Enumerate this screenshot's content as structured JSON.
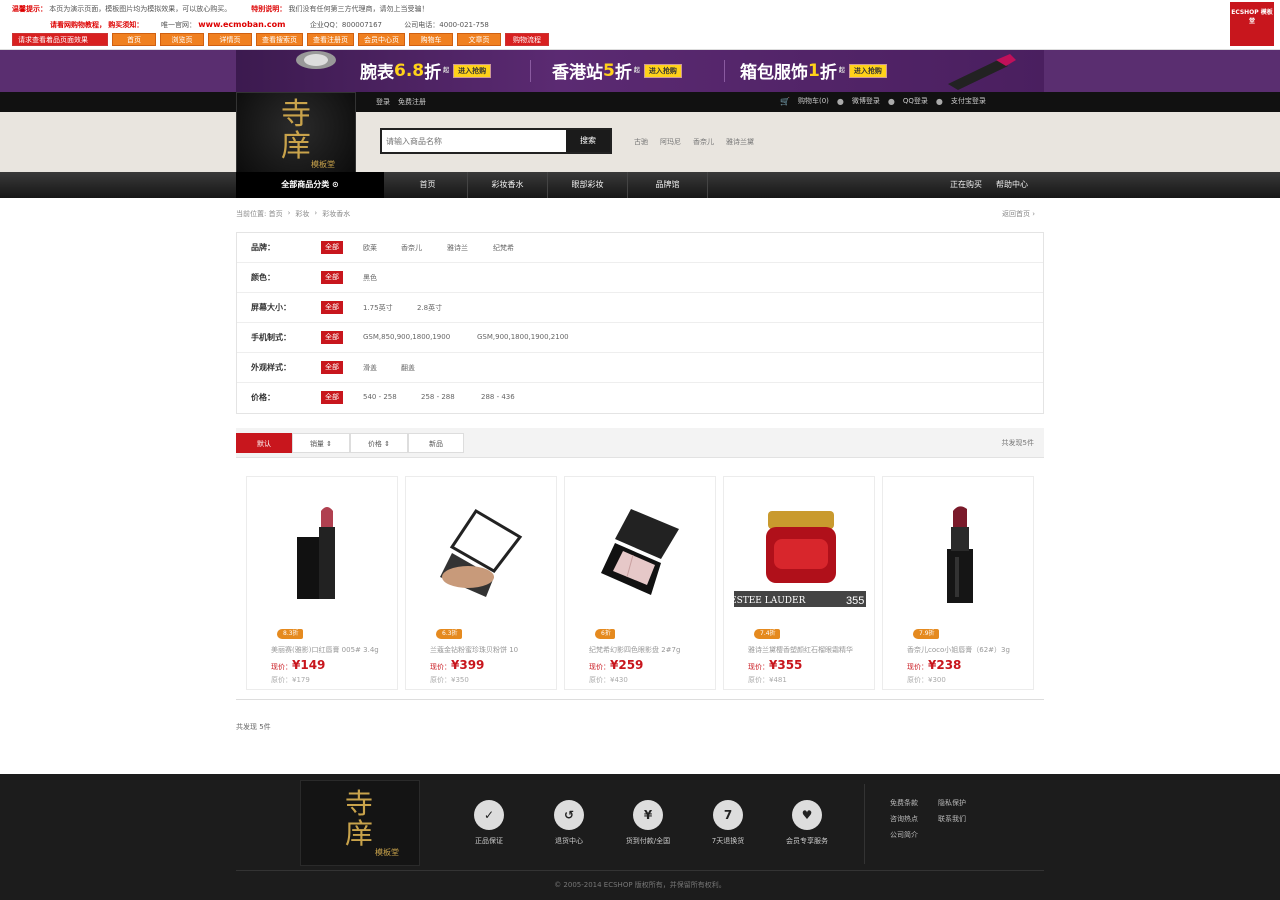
{
  "demo": {
    "line1_prefix": "温馨提示：",
    "line1_text": "本页为演示页面，模板图片均为模拟效果，可以放心购买。",
    "line1_hint": "特别说明：",
    "line1_hint_text": "我们没有任何第三方代理商，请勿上当受骗！",
    "line2_prefix": "请看网购物教程，",
    "line2_notice": "购买须知：",
    "line2_site_label": "唯一官网：",
    "line2_site": "www.ecmoban.com",
    "line2_qq": "企业QQ：800007167",
    "line2_phone": "公司电话：4000-021-758",
    "buttons": [
      "请求查看着品页面效果",
      "首页",
      "浏览页",
      "详情页",
      "查看搜索页",
      "查看注册页",
      "会员中心页",
      "购物车",
      "文章页",
      "购物流程"
    ],
    "ecs_logo": "ECSHOP 模板堂"
  },
  "banner": {
    "promos": [
      {
        "text": "腕表",
        "num": "6.8",
        "unit": "折",
        "small": "起",
        "go": "进入抢购"
      },
      {
        "text": "香港站",
        "num": "5",
        "unit": "折",
        "small": "起",
        "go": "进入抢购"
      },
      {
        "text": "箱包服饰",
        "num": "1",
        "unit": "折",
        "small": "起",
        "go": "进入抢购"
      }
    ]
  },
  "topstrip": {
    "login": "登录",
    "register": "免费注册",
    "cart": "购物车(0)",
    "weibo": "微博登录",
    "qq": "QQ登录",
    "alipay": "支付宝登录"
  },
  "logo": {
    "glyph": "寺庠",
    "sub": "模板堂"
  },
  "search": {
    "placeholder": "请输入商品名称",
    "button": "搜索",
    "hot_words": [
      "古驰",
      "阿玛尼",
      "香奈儿",
      "雅诗兰黛"
    ]
  },
  "nav": {
    "category": "全部商品分类",
    "items": [
      "首页",
      "彩妆香水",
      "眼部彩妆",
      "品牌馆"
    ],
    "right": [
      "正在购买",
      "帮助中心"
    ]
  },
  "breadcrumb": {
    "items": [
      "当前位置: 首页",
      "彩妆",
      "彩妆香水"
    ],
    "back": "返回首页"
  },
  "filters": [
    {
      "label": "品牌：",
      "all": "全部",
      "options": [
        "欧莱",
        "香奈儿",
        "雅诗兰",
        "纪梵希"
      ]
    },
    {
      "label": "颜色：",
      "all": "全部",
      "options": [
        "黑色"
      ]
    },
    {
      "label": "屏幕大小：",
      "all": "全部",
      "options": [
        "1.75英寸",
        "2.8英寸"
      ]
    },
    {
      "label": "手机制式：",
      "all": "全部",
      "options": [
        "GSM,850,900,1800,1900",
        "GSM,900,1800,1900,2100"
      ]
    },
    {
      "label": "外观样式：",
      "all": "全部",
      "options": [
        "滑盖",
        "翻盖"
      ]
    },
    {
      "label": "价格：",
      "all": "全部",
      "options": [
        "540 - 258",
        "258 - 288",
        "288 - 436"
      ]
    }
  ],
  "sort": {
    "buttons": [
      "默认",
      "销量",
      "价格",
      "新品"
    ],
    "count": "共发现5件"
  },
  "products": [
    {
      "discount": "8.3折",
      "name": "美丽赛(雅影)口红唇膏 005# 3.4g",
      "price_label": "现价：",
      "price": "¥149",
      "orig": "原价：¥179"
    },
    {
      "discount": "6.3折",
      "name": "兰蔻金钻粉蜜珍珠贝粉饼 10",
      "price_label": "现价：",
      "price": "¥399",
      "orig": "原价：¥350"
    },
    {
      "discount": "6折",
      "name": "纪梵希幻影四色眼影盘 2#7g",
      "price_label": "现价：",
      "price": "¥259",
      "orig": "原价：¥430"
    },
    {
      "discount": "7.4折",
      "name": "雅诗兰黛樱香塑颜红石榴眼霜精华",
      "price_label": "现价：",
      "price": "¥355",
      "orig": "原价：¥481"
    },
    {
      "discount": "7.9折",
      "name": "香奈儿coco小姐唇膏（62#）3g",
      "price_label": "现价：",
      "price": "¥238",
      "orig": "原价：¥300"
    }
  ],
  "estee_label": "ESTEE LAUDER",
  "estee_price": "355",
  "total": "共发现 5件",
  "footer": {
    "services": [
      {
        "icon": "✓",
        "label": "正品保证"
      },
      {
        "icon": "↺",
        "label": "退货中心"
      },
      {
        "icon": "¥",
        "label": "货到付款/全国"
      },
      {
        "icon": "7",
        "label": "7天退换货"
      },
      {
        "icon": "♥",
        "label": "会员专享服务"
      }
    ],
    "links": [
      "免费条款",
      "隐私保护",
      "咨询热点",
      "联系我们",
      "公司简介"
    ],
    "copyright": "© 2005-2014 ECSHOP 版权所有，并保留所有权利。"
  }
}
